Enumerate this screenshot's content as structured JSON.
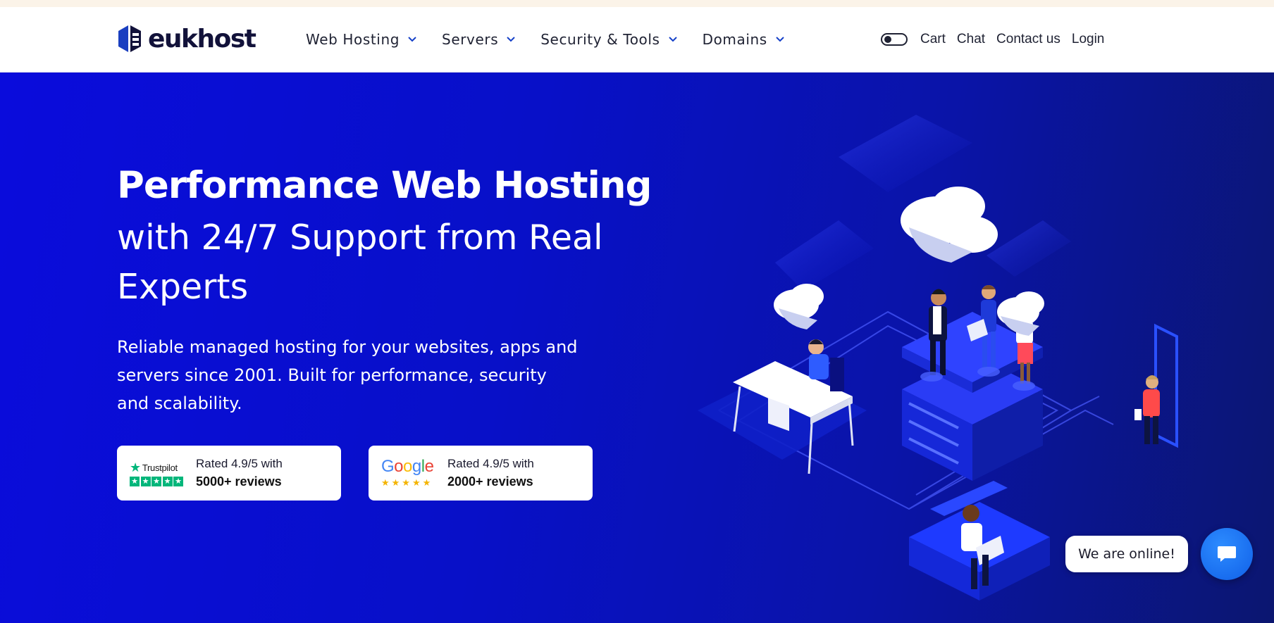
{
  "header": {
    "logo_text": "eukhost",
    "nav": [
      {
        "label": "Web Hosting"
      },
      {
        "label": "Servers"
      },
      {
        "label": "Security & Tools"
      },
      {
        "label": "Domains"
      }
    ],
    "links": {
      "cart": "Cart",
      "chat": "Chat",
      "contact": "Contact us",
      "login": "Login"
    },
    "theme_toggle": "dark-mode-toggle"
  },
  "hero": {
    "title_bold": "Performance Web Hosting",
    "title_rest": "with 24/7 Support from Real Experts",
    "lead": "Reliable managed hosting for your websites, apps and servers since 2001. Built for performance, security and scalability.",
    "badges": [
      {
        "brand": "Trustpilot",
        "line1": "Rated 4.9/5 with",
        "line2": "5000+ reviews"
      },
      {
        "brand": "Google",
        "line1": "Rated 4.9/5 with",
        "line2": "2000+ reviews"
      }
    ]
  },
  "chat": {
    "bubble_text": "We are online!",
    "button_icon": "chat-icon"
  },
  "colors": {
    "hero_background": "#0a0cdc",
    "brand_dark": "#12123a",
    "brand_blue": "#1540c8",
    "trustpilot_green": "#00b67a",
    "google_star": "#f4b400",
    "chat_button": "#1a73f0"
  }
}
